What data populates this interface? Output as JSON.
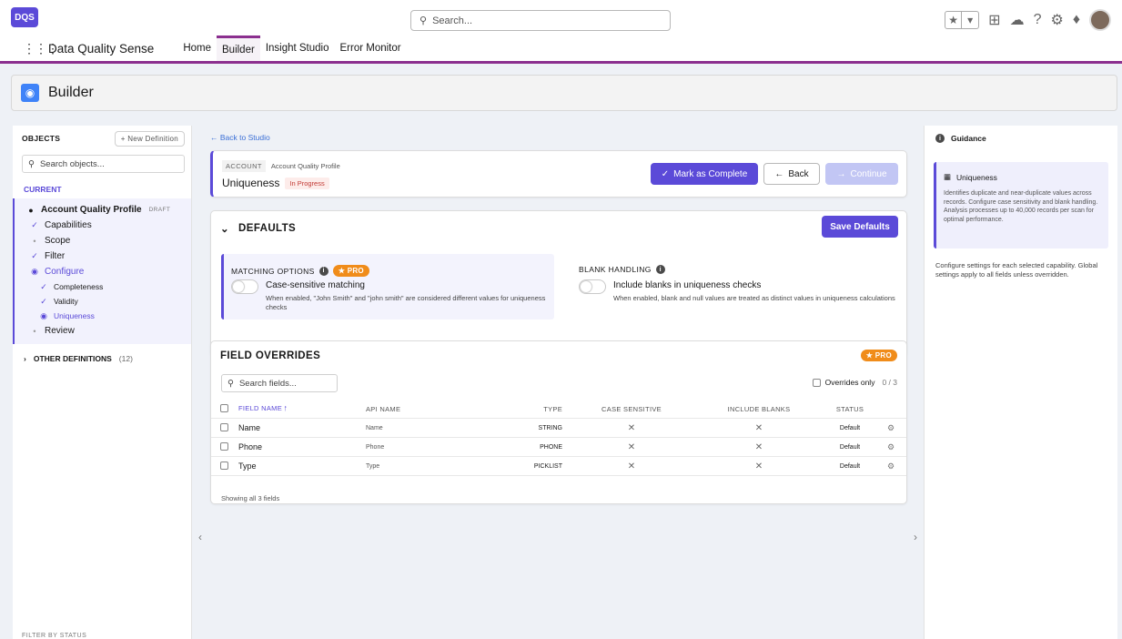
{
  "topbar": {
    "logo": "DQS",
    "search_placeholder": "Search...",
    "app_name": "Data Quality Sense",
    "tabs": [
      {
        "label": "Home",
        "active": false
      },
      {
        "label": "Builder",
        "active": true
      },
      {
        "label": "Insight Studio",
        "active": false
      },
      {
        "label": "Error Monitor",
        "active": false
      }
    ]
  },
  "header": {
    "title": "Builder",
    "icon": "compass-icon"
  },
  "left": {
    "objects_label": "OBJECTS",
    "new_definition": "New Definition",
    "search_placeholder": "Search objects...",
    "current_label": "CURRENT",
    "profile": "Account Quality Profile",
    "draft": "DRAFT",
    "steps": [
      {
        "label": "Capabilities",
        "state": "done"
      },
      {
        "label": "Scope",
        "state": "pending"
      },
      {
        "label": "Filter",
        "state": "done"
      },
      {
        "label": "Configure",
        "state": "active"
      }
    ],
    "substeps": [
      {
        "label": "Completeness",
        "state": "done"
      },
      {
        "label": "Validity",
        "state": "done"
      },
      {
        "label": "Uniqueness",
        "state": "active"
      }
    ],
    "review": "Review",
    "other_definitions": "OTHER DEFINITIONS",
    "other_count": "(12)",
    "footer": "FILTER BY STATUS"
  },
  "main": {
    "back_to_studio": "Back to Studio",
    "object_pill": "ACCOUNT",
    "profile_name": "Account Quality Profile",
    "title": "Uniqueness",
    "status": "In Progress",
    "mark_complete": "Mark as Complete",
    "back": "Back",
    "continue": "Continue",
    "defaults": {
      "title": "DEFAULTS",
      "save": "Save Defaults",
      "matching_label": "MATCHING OPTIONS",
      "pro": "PRO",
      "matching_title": "Case-sensitive matching",
      "matching_desc": "When enabled, \"John Smith\" and \"john smith\" are considered different values for uniqueness checks",
      "blank_label": "BLANK HANDLING",
      "blank_title": "Include blanks in uniqueness checks",
      "blank_desc": "When enabled, blank and null values are treated as distinct values in uniqueness calculations"
    },
    "overrides": {
      "title": "FIELD OVERRIDES",
      "pro": "PRO",
      "search_placeholder": "Search fields...",
      "overrides_only": "Overrides only",
      "count": "0 / 3",
      "columns": [
        "FIELD NAME",
        "API NAME",
        "TYPE",
        "CASE SENSITIVE",
        "INCLUDE BLANKS",
        "STATUS"
      ],
      "rows": [
        {
          "name": "Name",
          "api": "Name",
          "type": "STRING",
          "case": "✕",
          "blanks": "✕",
          "status": "Default"
        },
        {
          "name": "Phone",
          "api": "Phone",
          "type": "PHONE",
          "case": "✕",
          "blanks": "✕",
          "status": "Default"
        },
        {
          "name": "Type",
          "api": "Type",
          "type": "PICKLIST",
          "case": "✕",
          "blanks": "✕",
          "status": "Default"
        }
      ],
      "footer": "Showing all 3 fields"
    }
  },
  "guidance": {
    "title": "Guidance",
    "card_title": "Uniqueness",
    "card_body": "Identifies duplicate and near-duplicate values across records. Configure case sensitivity and blank handling. Analysis processes up to 40,000 records per scan for optimal performance.",
    "text": "Configure settings for each selected capability. Global settings apply to all fields unless overridden."
  },
  "colors": {
    "accent": "#5b4ad8",
    "nav_accent": "#8b2f8f",
    "pro": "#f08c1a",
    "status_bg": "#fdecea"
  }
}
